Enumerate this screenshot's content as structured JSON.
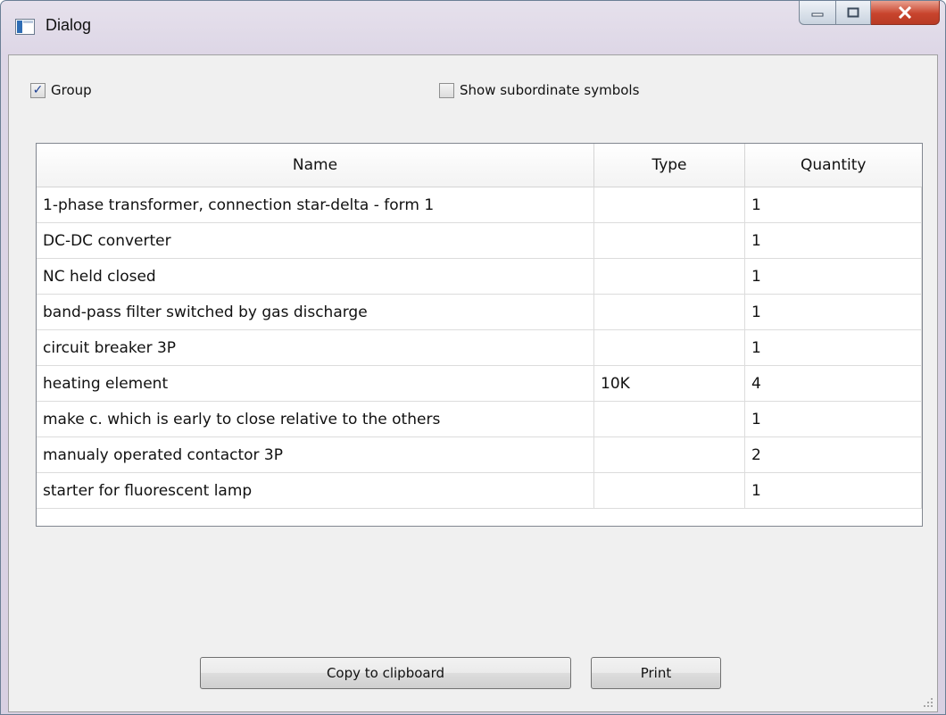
{
  "window": {
    "title": "Dialog"
  },
  "options": {
    "group": {
      "label": "Group",
      "checked": true
    },
    "show_subordinate": {
      "label": "Show subordinate symbols",
      "checked": false
    }
  },
  "table": {
    "headers": {
      "name": "Name",
      "type": "Type",
      "quantity": "Quantity"
    },
    "rows": [
      {
        "name": "1-phase transformer, connection star-delta - form 1",
        "type": "",
        "quantity": "1"
      },
      {
        "name": "DC-DC converter",
        "type": "",
        "quantity": "1"
      },
      {
        "name": "NC held closed",
        "type": "",
        "quantity": "1"
      },
      {
        "name": "band-pass filter switched by gas discharge",
        "type": "",
        "quantity": "1"
      },
      {
        "name": "circuit breaker 3P",
        "type": "",
        "quantity": "1"
      },
      {
        "name": "heating element",
        "type": "10K",
        "quantity": "4"
      },
      {
        "name": "make c. which is early to close relative to the others",
        "type": "",
        "quantity": "1"
      },
      {
        "name": "manualy operated contactor 3P",
        "type": "",
        "quantity": "2"
      },
      {
        "name": "starter for fluorescent lamp",
        "type": "",
        "quantity": "1"
      }
    ]
  },
  "buttons": {
    "copy": "Copy to clipboard",
    "print": "Print"
  },
  "icons": {
    "app": "dialog-app-icon",
    "minimize": "minimize-icon",
    "maximize": "maximize-icon",
    "close": "close-icon"
  }
}
